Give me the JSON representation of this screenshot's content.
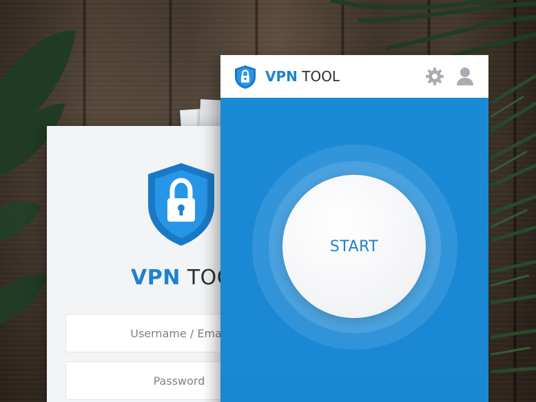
{
  "brand": {
    "name_part1": "VPN",
    "name_part2": "TOOL",
    "accent_color": "#1d82d0"
  },
  "login": {
    "username_placeholder": "Username / Email",
    "password_placeholder": "Password"
  },
  "main": {
    "header_icons": [
      "shield-lock-icon",
      "gear-icon",
      "user-icon"
    ],
    "start_label": "START",
    "body_color": "#1b8ad6"
  }
}
